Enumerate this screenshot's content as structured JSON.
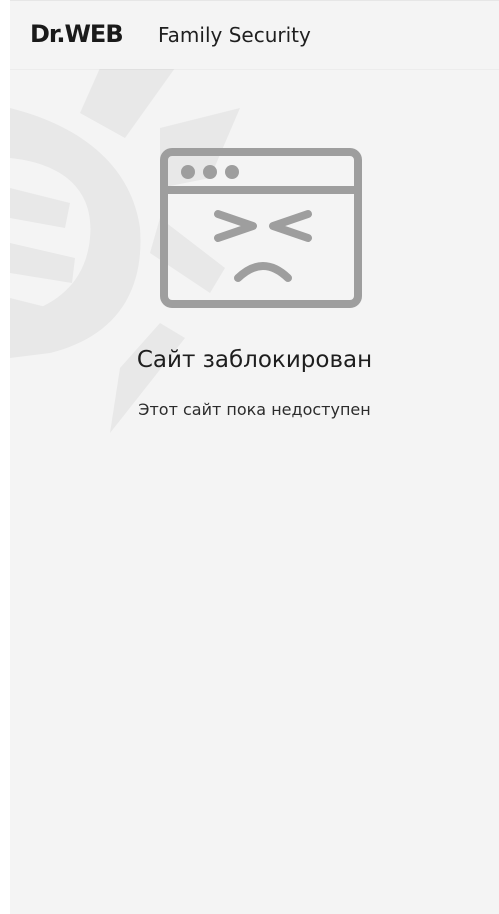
{
  "header": {
    "logo_text": "Dr.WEB",
    "product_name": "Family Security"
  },
  "blocked_page": {
    "title": "Сайт заблокирован",
    "message": "Этот сайт пока недоступен",
    "illustration_icon": "blocked-browser-sad-face-icon",
    "watermark_icon": "drweb-spider-watermark-icon"
  },
  "colors": {
    "background": "#f4f4f4",
    "illustration": "#9e9e9e",
    "watermark": "#e9e9e9",
    "text": "#1e1e1e"
  }
}
